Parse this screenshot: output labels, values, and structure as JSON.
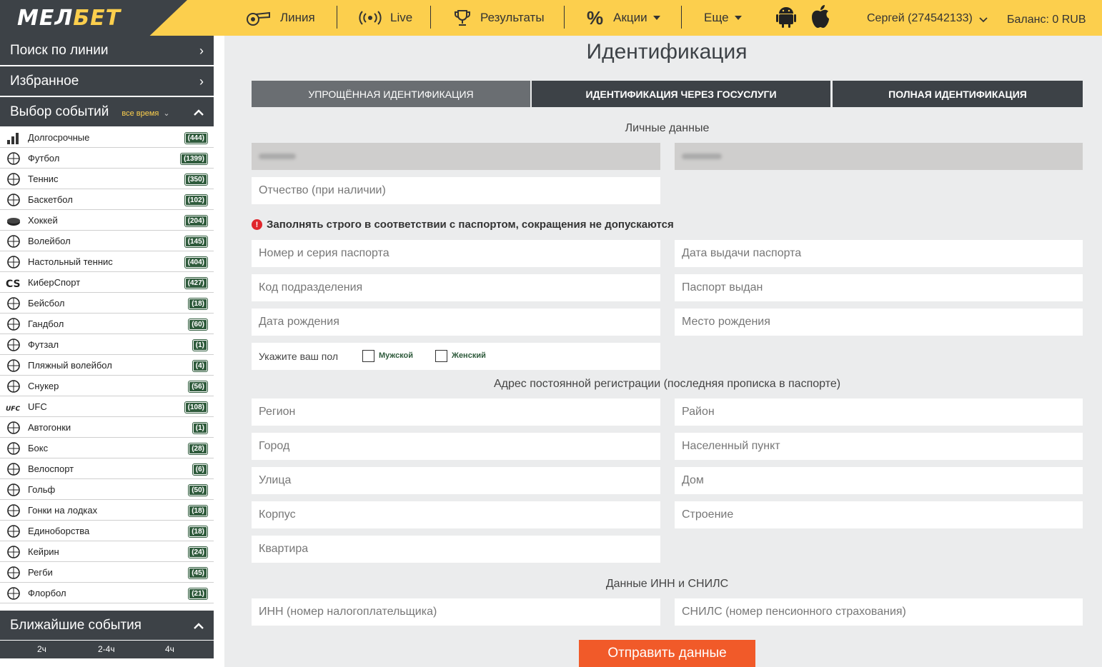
{
  "brand": {
    "logo_main": "МЕЛ",
    "logo_accent": "БЕТ"
  },
  "header": {
    "nav": [
      {
        "label": "Линия",
        "icon": "whistle-icon"
      },
      {
        "label": "Live",
        "icon": "broadcast-icon"
      },
      {
        "label": "Результаты",
        "icon": "trophy-icon"
      },
      {
        "label": "Акции",
        "icon": "percent-icon"
      },
      {
        "label": "Еще",
        "icon": ""
      }
    ],
    "user": "Сергей (274542133)",
    "balance": "Баланс: 0 RUB"
  },
  "sidebar": {
    "search_line": "Поиск по линии",
    "favorites": "Избранное",
    "events_title": "Выбор событий",
    "events_filter": "все время",
    "sports": [
      {
        "name": "Долгосрочные",
        "count": "(444)",
        "icon": "bar-chart-icon"
      },
      {
        "name": "Футбол",
        "count": "(1399)",
        "icon": "soccer-ball-icon"
      },
      {
        "name": "Теннис",
        "count": "(350)",
        "icon": "tennis-ball-icon"
      },
      {
        "name": "Баскетбол",
        "count": "(102)",
        "icon": "basketball-icon"
      },
      {
        "name": "Хоккей",
        "count": "(204)",
        "icon": "hockey-puck-icon"
      },
      {
        "name": "Волейбол",
        "count": "(145)",
        "icon": "volleyball-icon"
      },
      {
        "name": "Настольный теннис",
        "count": "(404)",
        "icon": "ping-pong-icon"
      },
      {
        "name": "КиберСпорт",
        "count": "(427)",
        "icon": "cs-icon"
      },
      {
        "name": "Бейсбол",
        "count": "(18)",
        "icon": "baseball-icon"
      },
      {
        "name": "Гандбол",
        "count": "(60)",
        "icon": "handball-icon"
      },
      {
        "name": "Футзал",
        "count": "(1)",
        "icon": "futsal-ball-icon"
      },
      {
        "name": "Пляжный волейбол",
        "count": "(4)",
        "icon": "beach-volleyball-icon"
      },
      {
        "name": "Снукер",
        "count": "(56)",
        "icon": "snooker-icon"
      },
      {
        "name": "UFC",
        "count": "(108)",
        "icon": "ufc-icon"
      },
      {
        "name": "Автогонки",
        "count": "(1)",
        "icon": "steering-wheel-icon"
      },
      {
        "name": "Бокс",
        "count": "(28)",
        "icon": "boxing-glove-icon"
      },
      {
        "name": "Велоспорт",
        "count": "(6)",
        "icon": "cyclist-icon"
      },
      {
        "name": "Гольф",
        "count": "(50)",
        "icon": "golf-icon"
      },
      {
        "name": "Гонки на лодках",
        "count": "(18)",
        "icon": "boat-icon"
      },
      {
        "name": "Единоборства",
        "count": "(18)",
        "icon": "yin-yang-icon"
      },
      {
        "name": "Кейрин",
        "count": "(24)",
        "icon": "keirin-icon"
      },
      {
        "name": "Регби",
        "count": "(45)",
        "icon": "rugby-ball-icon"
      },
      {
        "name": "Флорбол",
        "count": "(21)",
        "icon": "floorball-icon"
      }
    ],
    "nearest_title": "Ближайшие события",
    "nearest_tabs": [
      "2ч",
      "2-4ч",
      "4ч"
    ]
  },
  "main": {
    "title": "Идентификация",
    "tabs": [
      "УПРОЩЁННАЯ ИДЕНТИФИКАЦИЯ",
      "ИДЕНТИФИКАЦИЯ ЧЕРЕЗ ГОСУСЛУГИ",
      "ПОЛНАЯ ИДЕНТИФИКАЦИЯ"
    ],
    "personal_label": "Личные данные",
    "patronymic_placeholder": "Отчество (при наличии)",
    "warning": "Заполнять строго в соответствии с паспортом, сокращения не допускаются",
    "passport_number": "Номер и серия паспорта",
    "passport_date": "Дата выдачи паспорта",
    "division_code": "Код подразделения",
    "passport_issued": "Паспорт выдан",
    "birth_date": "Дата рождения",
    "birth_place": "Место рождения",
    "gender_label": "Укажите ваш пол",
    "gender_male": "Мужской",
    "gender_female": "Женский",
    "address_label": "Адрес постоянной регистрации (последняя прописка в паспорте)",
    "region": "Регион",
    "district": "Район",
    "city": "Город",
    "settlement": "Населенный пункт",
    "street": "Улица",
    "house": "Дом",
    "block": "Корпус",
    "building": "Строение",
    "apartment": "Квартира",
    "inn_label": "Данные ИНН и СНИЛС",
    "inn": "ИНН (номер налогоплательщика)",
    "snils": "СНИЛС (номер пенсионного страхования)",
    "submit": "Отправить данные"
  }
}
